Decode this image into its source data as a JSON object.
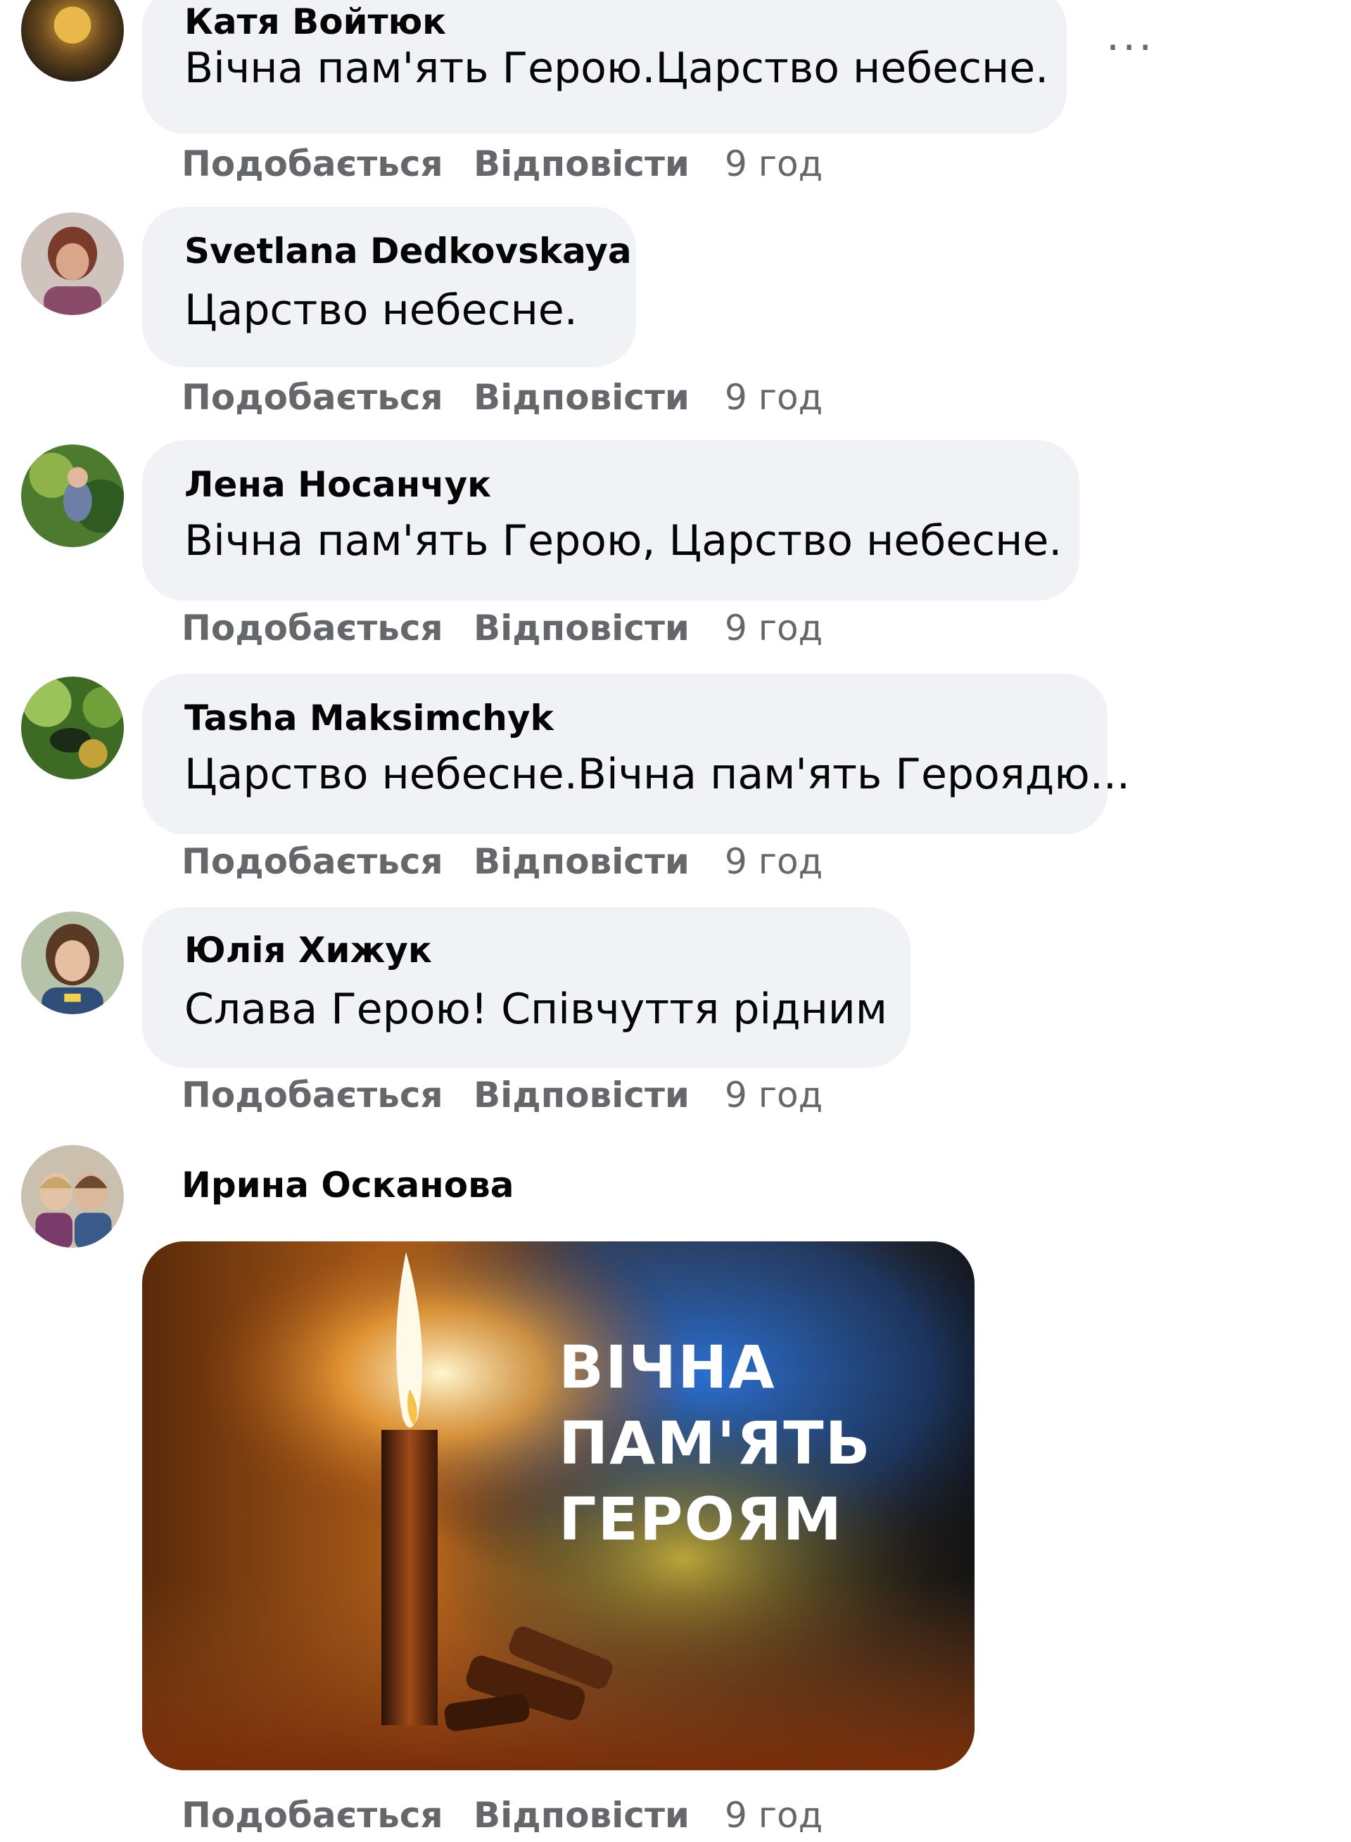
{
  "actions": {
    "like": "Подобається",
    "reply": "Відповісти"
  },
  "comments": [
    {
      "author": "Катя Войтюк",
      "text": "Вічна пам'ять Герою.Царство небесне.",
      "time": "9 год"
    },
    {
      "author": "Svetlana Dedkovskaya",
      "text": "Царство небесне.",
      "time": "9 год"
    },
    {
      "author": "Лена Носанчук",
      "text": "Вічна пам'ять Герою, Царство небесне.",
      "time": "9 год"
    },
    {
      "author": "Tasha Maksimchyk",
      "text": "Царство небесне.Вічна пам'ять Героядю...",
      "time": "9 год"
    },
    {
      "author": "Юлія Хижук",
      "text": "Слава Герою! Співчуття рідним",
      "time": "9 год"
    },
    {
      "author": "Ирина Осканова",
      "time": "9 год",
      "image": {
        "line1": "ВІЧНА",
        "line2": "ПАМ'ЯТЬ",
        "line3": "ГЕРОЯМ"
      }
    }
  ],
  "icons": {
    "more": "more-horizontal-icon"
  }
}
